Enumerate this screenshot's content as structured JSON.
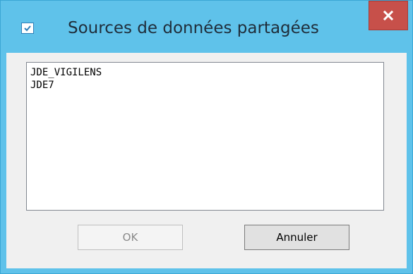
{
  "window": {
    "title": "Sources de données partagées",
    "icons": {
      "app": "checkbox-app-icon",
      "close": "close-x-icon"
    },
    "colors": {
      "frame": "#5fc2ea",
      "close_button": "#c7504a",
      "client": "#f0f0f0"
    }
  },
  "list": {
    "items": [
      "JDE_VIGILENS",
      "JDE7"
    ]
  },
  "buttons": {
    "ok_label": "OK",
    "ok_enabled": false,
    "cancel_label": "Annuler"
  }
}
